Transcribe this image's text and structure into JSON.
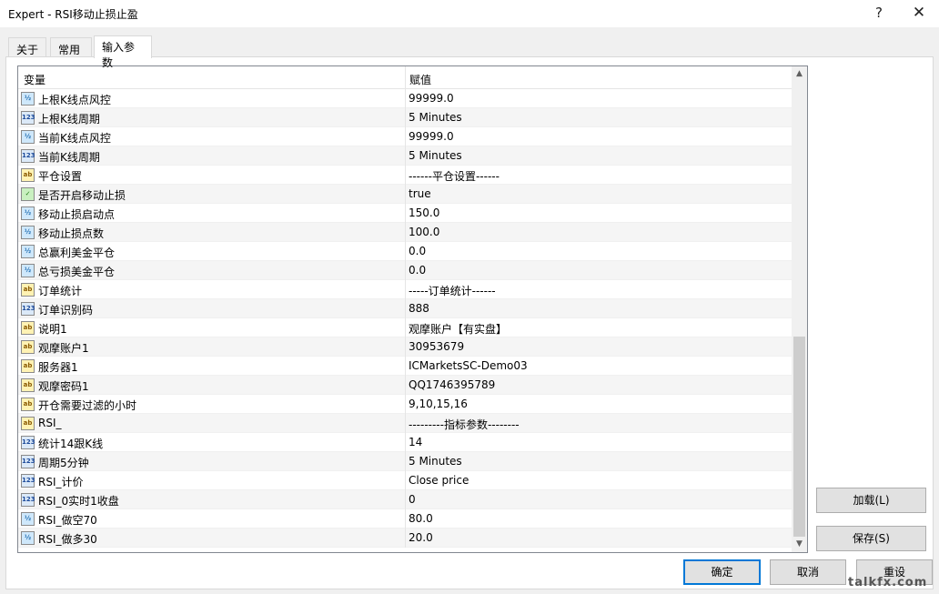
{
  "window": {
    "title": "Expert - RSI移动止损止盈",
    "help_label": "?",
    "close_label": "✕"
  },
  "tabs": [
    {
      "label": "关于",
      "active": false
    },
    {
      "label": "常用",
      "active": false
    },
    {
      "label": "输入参数",
      "active": true
    }
  ],
  "grid": {
    "col_variable": "变量",
    "col_value": "赋值",
    "rows": [
      {
        "icon": "double-icon",
        "name": "上根K线点风控",
        "value": "99999.0"
      },
      {
        "icon": "integer-icon",
        "name": "上根K线周期",
        "value": "5 Minutes"
      },
      {
        "icon": "double-icon",
        "name": "当前K线点风控",
        "value": "99999.0"
      },
      {
        "icon": "integer-icon",
        "name": "当前K线周期",
        "value": "5 Minutes"
      },
      {
        "icon": "string-icon",
        "name": "平仓设置",
        "value": "------平仓设置------"
      },
      {
        "icon": "bool-icon",
        "name": "是否开启移动止损",
        "value": "true"
      },
      {
        "icon": "double-icon",
        "name": "移动止损启动点",
        "value": "150.0"
      },
      {
        "icon": "double-icon",
        "name": "移动止损点数",
        "value": "100.0"
      },
      {
        "icon": "double-icon",
        "name": "总赢利美金平仓",
        "value": "0.0"
      },
      {
        "icon": "double-icon",
        "name": "总亏损美金平仓",
        "value": "0.0"
      },
      {
        "icon": "string-icon",
        "name": "订单统计",
        "value": "-----订单统计------"
      },
      {
        "icon": "integer-icon",
        "name": "订单识别码",
        "value": "888"
      },
      {
        "icon": "string-icon",
        "name": "说明1",
        "value": "观摩账户【有实盘】"
      },
      {
        "icon": "string-icon",
        "name": "观摩账户1",
        "value": "30953679"
      },
      {
        "icon": "string-icon",
        "name": "服务器1",
        "value": "ICMarketsSC-Demo03"
      },
      {
        "icon": "string-icon",
        "name": "观摩密码1",
        "value": "QQ1746395789"
      },
      {
        "icon": "string-icon",
        "name": "开仓需要过滤的小时",
        "value": "9,10,15,16"
      },
      {
        "icon": "string-icon",
        "name": "RSI_",
        "value": "---------指标参数--------"
      },
      {
        "icon": "integer-icon",
        "name": "统计14跟K线",
        "value": "14"
      },
      {
        "icon": "integer-icon",
        "name": "周期5分钟",
        "value": "5 Minutes"
      },
      {
        "icon": "integer-icon",
        "name": "RSI_计价",
        "value": "Close price"
      },
      {
        "icon": "integer-icon",
        "name": "RSI_0实时1收盘",
        "value": "0"
      },
      {
        "icon": "double-icon",
        "name": "RSI_做空70",
        "value": "80.0"
      },
      {
        "icon": "double-icon",
        "name": "RSI_做多30",
        "value": "20.0"
      }
    ]
  },
  "icons": {
    "double-icon": "½",
    "integer-icon": "123",
    "string-icon": "ab",
    "bool-icon": "✓"
  },
  "buttons": {
    "load": "加载(L)",
    "save": "保存(S)",
    "ok": "确定",
    "cancel": "取消",
    "reset": "重设"
  },
  "watermark": "talkfx.com"
}
